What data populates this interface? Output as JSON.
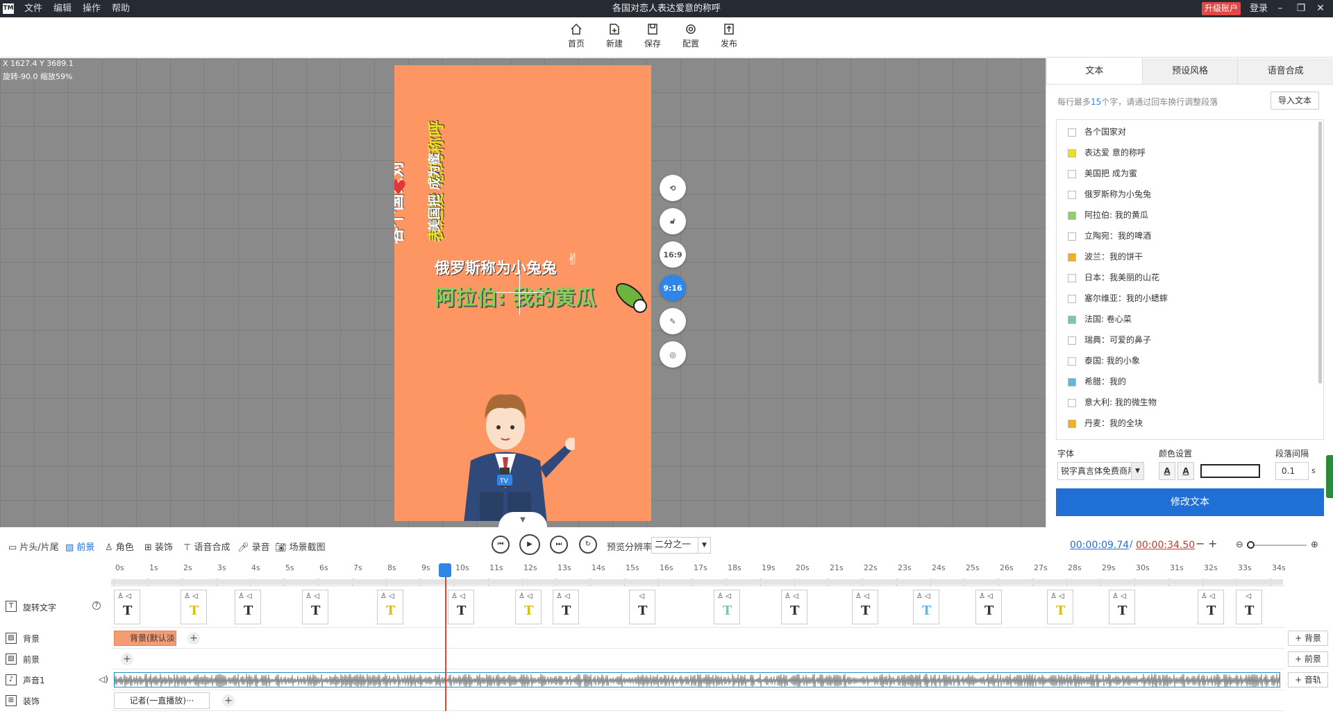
{
  "app": {
    "logo": "TM",
    "menu": [
      "文件",
      "编辑",
      "操作",
      "帮助"
    ],
    "title": "各国对恋人表达爱意的称呼",
    "upgrade": "升级账户",
    "login": "登录",
    "window_controls": [
      "minimize-icon",
      "restore-icon",
      "close-icon"
    ]
  },
  "toolbar": {
    "home": "首页",
    "new": "新建",
    "save": "保存",
    "config": "配置",
    "publish": "发布"
  },
  "canvas": {
    "coords": "X 1627.4 Y 3689.1",
    "transform": "旋转-90.0 缩放59%",
    "background_color": "#fe9664",
    "line1": "俄罗斯称为小兔兔",
    "line2": "阿拉伯: 我的黄瓜",
    "rot_line1": "各个国家对",
    "rot_line2": "表达爱 意的称呼",
    "rot_line3": "美国把 成为蜜",
    "mic_badge": "TV",
    "side_buttons": {
      "rotate": "rotate-icon",
      "lock": "lock-icon",
      "ratio_16_9": "16:9",
      "ratio_9_16": "9:16",
      "edit": "edit-icon",
      "target": "target-icon"
    }
  },
  "panel": {
    "tabs": [
      "文本",
      "预设风格",
      "语音合成"
    ],
    "hint_prefix": "每行最多",
    "hint_count": "15",
    "hint_suffix": "个字，请通过回车换行调整段落",
    "import_button": "导入文本",
    "items": [
      {
        "label": "各个国家对",
        "color": "#ffffff"
      },
      {
        "label": "表达爱   意的称呼",
        "color": "#e8e020"
      },
      {
        "label": "美国把   成为蜜",
        "color": "#ffffff"
      },
      {
        "label": "俄罗斯称为小兔兔",
        "color": "#ffffff"
      },
      {
        "label": "阿拉伯: 我的黄瓜",
        "color": "#8fd16a"
      },
      {
        "label": "立陶宛：我的啤酒",
        "color": "#ffffff"
      },
      {
        "label": "波兰：我的饼干",
        "color": "#f2b21e"
      },
      {
        "label": "日本：我美丽的山花",
        "color": "#ffffff"
      },
      {
        "label": "塞尔维亚：我的小蟋蟀",
        "color": "#ffffff"
      },
      {
        "label": "法国: 卷心菜",
        "color": "#7fc7a0"
      },
      {
        "label": "瑞典：可爱的鼻子",
        "color": "#ffffff"
      },
      {
        "label": "泰国: 我的小象",
        "color": "#ffffff"
      },
      {
        "label": "希腊：我的",
        "color": "#5ab8e8"
      },
      {
        "label": "意大利: 我的微生物",
        "color": "#ffffff"
      },
      {
        "label": "丹麦：我的全块",
        "color": "#f2b21e"
      }
    ],
    "font_label": "字体",
    "font_value": "锐字真言体免费商用",
    "color_label": "颜色设置",
    "spacing_label": "段落间隔",
    "spacing_value": "0.1",
    "spacing_unit": "s",
    "modify_button": "修改文本"
  },
  "timeline": {
    "tabs": [
      "片头/片尾",
      "前景",
      "角色",
      "装饰",
      "语音合成",
      "录音",
      "场景截图"
    ],
    "active_tab": "前景",
    "preview_label": "预览分辨率",
    "preview_value": "二分之一",
    "current_time": "00:00:09.74",
    "separator": "/",
    "total_time": "00:00:34.50",
    "ticks": [
      "0s",
      "1s",
      "2s",
      "3s",
      "4s",
      "5s",
      "6s",
      "7s",
      "8s",
      "9s",
      "10s",
      "11s",
      "12s",
      "13s",
      "14s",
      "15s",
      "16s",
      "17s",
      "18s",
      "19s",
      "20s",
      "21s",
      "22s",
      "23s",
      "24s",
      "25s",
      "26s",
      "27s",
      "28s",
      "29s",
      "30s",
      "31s",
      "32s",
      "33s",
      "34s"
    ],
    "playhead_seconds": 9.74,
    "tracks": {
      "text": "旋转文字",
      "background": "背景",
      "foreground": "前景",
      "audio": "声音1",
      "decoration": "装饰"
    },
    "bg_clip": "背景(默认淡",
    "deco_clip": "记者(一直播放)···",
    "add_background": "+ 背景",
    "add_foreground": "+ 前景",
    "add_audio": "+ 音轨"
  }
}
